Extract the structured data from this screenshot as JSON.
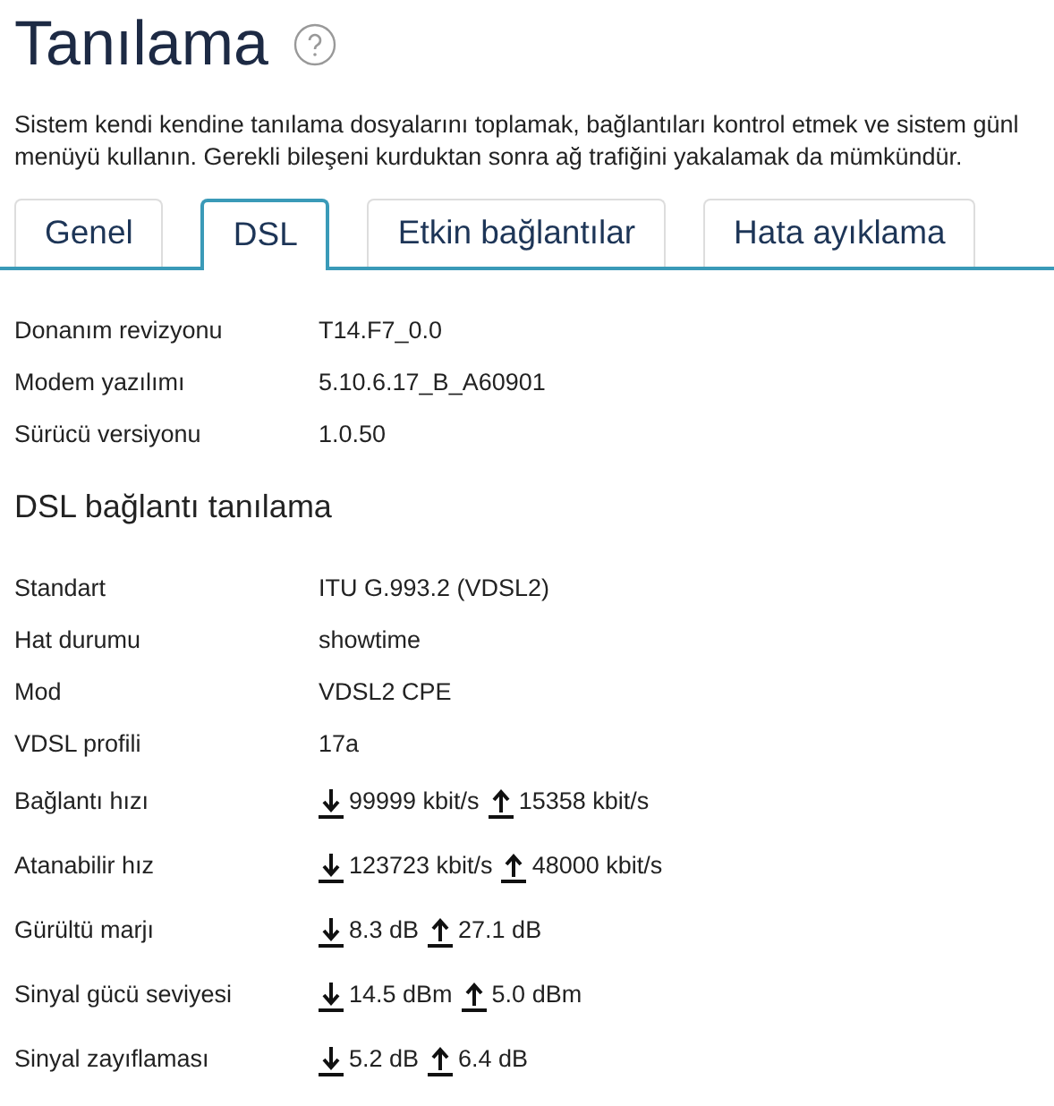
{
  "title": "Tanılama",
  "description_lines": [
    "Sistem kendi kendine tanılama dosyalarını toplamak, bağlantıları kontrol etmek ve sistem günl",
    "menüyü kullanın. Gerekli bileşeni kurduktan sonra ağ trafiğini yakalamak da mümkündür."
  ],
  "tabs": [
    {
      "label": "Genel",
      "selected": false
    },
    {
      "label": "DSL",
      "selected": true
    },
    {
      "label": "Etkin bağlantılar",
      "selected": false
    },
    {
      "label": "Hata ayıklama",
      "selected": false
    }
  ],
  "device_info": [
    {
      "label": "Donanım revizyonu",
      "kind": "text",
      "value": "T14.F7_0.0"
    },
    {
      "label": "Modem yazılımı",
      "kind": "text",
      "value": "5.10.6.17_B_A60901"
    },
    {
      "label": "Sürücü versiyonu",
      "kind": "text",
      "value": "1.0.50"
    }
  ],
  "section_title": "DSL bağlantı tanılama",
  "dsl_info": [
    {
      "label": "Standart",
      "kind": "text",
      "value": "ITU G.993.2 (VDSL2)"
    },
    {
      "label": "Hat durumu",
      "kind": "text",
      "value": "showtime"
    },
    {
      "label": "Mod",
      "kind": "text",
      "value": "VDSL2 CPE"
    },
    {
      "label": "VDSL profili",
      "kind": "text",
      "value": "17a"
    },
    {
      "label": "Bağlantı hızı",
      "kind": "updown",
      "down": "99999 kbit/s",
      "up": "15358 kbit/s"
    },
    {
      "label": "Atanabilir hız",
      "kind": "updown",
      "down": "123723 kbit/s",
      "up": "48000 kbit/s"
    },
    {
      "label": "Gürültü marjı",
      "kind": "updown",
      "down": "8.3 dB",
      "up": "27.1 dB"
    },
    {
      "label": "Sinyal gücü seviyesi",
      "kind": "updown",
      "down": "14.5 dBm",
      "up": "5.0 dBm"
    },
    {
      "label": "Sinyal zayıflaması",
      "kind": "updown",
      "down": "5.2 dB",
      "up": "6.4 dB"
    }
  ]
}
